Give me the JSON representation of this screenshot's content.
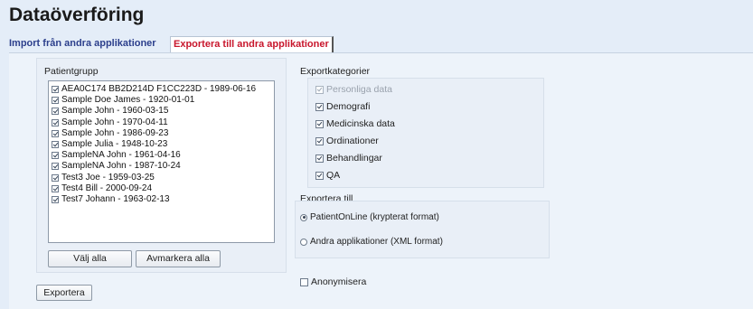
{
  "page": {
    "title": "Dataöverföring"
  },
  "tabs": [
    {
      "label": "Import från andra applikationer",
      "active": false
    },
    {
      "label": "Exportera till andra applikationer",
      "active": true
    }
  ],
  "patient_group": {
    "label": "Patientgrupp",
    "items": [
      {
        "label": "AEA0C174 BB2D214D F1CC223D - 1989-06-16",
        "checked": true
      },
      {
        "label": "Sample Doe James - 1920-01-01",
        "checked": true
      },
      {
        "label": "Sample John - 1960-03-15",
        "checked": true
      },
      {
        "label": "Sample John - 1970-04-11",
        "checked": true
      },
      {
        "label": "Sample John - 1986-09-23",
        "checked": true
      },
      {
        "label": "Sample Julia - 1948-10-23",
        "checked": true
      },
      {
        "label": "SampleNA John - 1961-04-16",
        "checked": true
      },
      {
        "label": "SampleNA John - 1987-10-24",
        "checked": true
      },
      {
        "label": "Test3 Joe - 1959-03-25",
        "checked": true
      },
      {
        "label": "Test4 Bill - 2000-09-24",
        "checked": true
      },
      {
        "label": "Test7 Johann - 1963-02-13",
        "checked": true
      }
    ],
    "select_all": "Välj alla",
    "deselect_all": "Avmarkera alla"
  },
  "export_categories": {
    "label": "Exportkategorier",
    "items": [
      {
        "label": "Personliga data",
        "checked": true,
        "disabled": true
      },
      {
        "label": "Demografi",
        "checked": true,
        "disabled": false
      },
      {
        "label": "Medicinska data",
        "checked": true,
        "disabled": false
      },
      {
        "label": "Ordinationer",
        "checked": true,
        "disabled": false
      },
      {
        "label": "Behandlingar",
        "checked": true,
        "disabled": false
      },
      {
        "label": "QA",
        "checked": true,
        "disabled": false
      }
    ]
  },
  "export_to": {
    "label": "Exportera till",
    "options": [
      {
        "label": "PatientOnLine (krypterat format)",
        "selected": true
      },
      {
        "label": "Andra applikationer (XML format)",
        "selected": false
      }
    ]
  },
  "anonymize": {
    "label": "Anonymisera",
    "checked": false
  },
  "export_button": "Exportera",
  "colors": {
    "background": "#e4edf8",
    "active_tab_text": "#c8162c",
    "inactive_tab_text": "#2c3f8c"
  }
}
